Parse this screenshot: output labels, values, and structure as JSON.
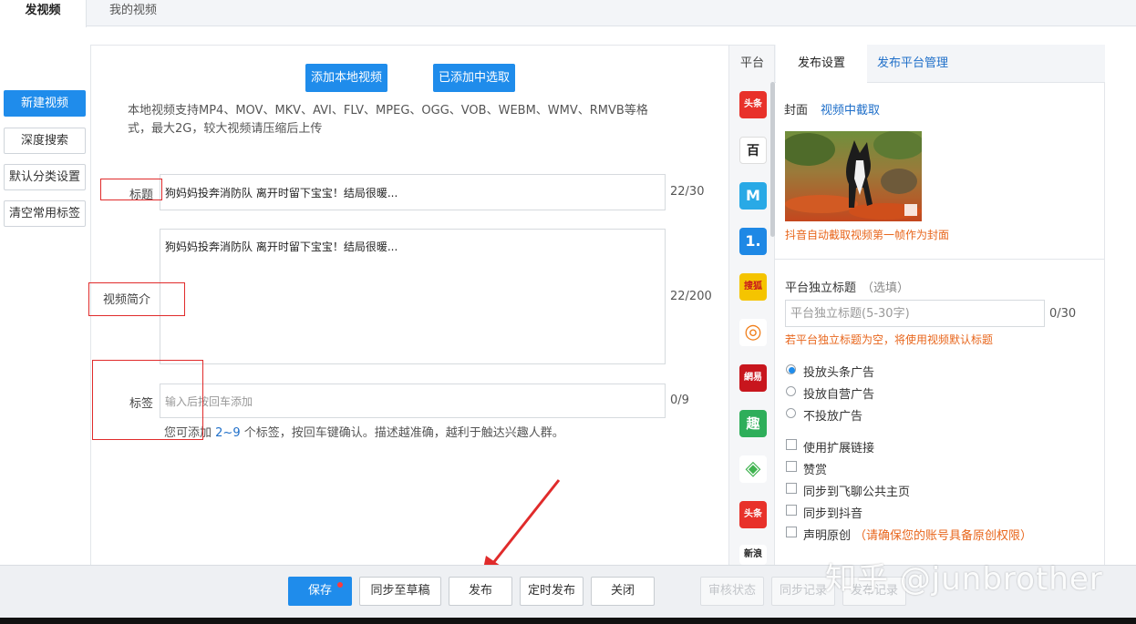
{
  "top_tabs": [
    "发视频",
    "我的视频"
  ],
  "sidebar": {
    "items": [
      "新建视频",
      "深度搜索",
      "默认分类设置",
      "清空常用标签"
    ]
  },
  "upload": {
    "add_local_label": "添加本地视频",
    "choose_added_label": "已添加中选取",
    "format_hint_line1": "本地视频支持MP4、MOV、MKV、AVI、FLV、MPEG、OGG、VOB、WEBM、WMV、RMVB等格",
    "format_hint_line2": "式，最大2G，较大视频请压缩后上传"
  },
  "form": {
    "title_label": "标题",
    "title_value": "狗妈妈投奔消防队 离开时留下宝宝！结局很暖...",
    "title_count": "22/30",
    "intro_label": "视频简介",
    "intro_value": "狗妈妈投奔消防队 离开时留下宝宝！结局很暖...",
    "intro_count": "22/200",
    "tags_label": "标签",
    "tags_placeholder": "输入后按回车添加",
    "tags_count": "0/9",
    "tags_hint_pre": "您可添加",
    "tags_hint_range": "2~9",
    "tags_hint_post": "个标签，按回车键确认。描述越准确，越利于触达兴趣人群。"
  },
  "platforms": {
    "header": "平台",
    "icons": [
      {
        "name": "toutiao-icon",
        "text": "头条",
        "color": "#e8312a"
      },
      {
        "name": "baidu-baijia-icon",
        "text": "百",
        "color": "#ffffff"
      },
      {
        "name": "m-platform-icon",
        "text": "M",
        "color": "#29a9e6"
      },
      {
        "name": "yidian-icon",
        "text": "1.",
        "color": "#1e88e5"
      },
      {
        "name": "sohu-icon",
        "text": "搜狐",
        "color": "#f5c400"
      },
      {
        "name": "spiral-icon",
        "text": "◎",
        "color": "#ffffff"
      },
      {
        "name": "netease-icon",
        "text": "網易",
        "color": "#c8161d"
      },
      {
        "name": "qutoutiao-icon",
        "text": "趣",
        "color": "#2eae5a"
      },
      {
        "name": "diamond-icon",
        "text": "◈",
        "color": "#ffffff"
      },
      {
        "name": "toutiao-alt-icon",
        "text": "头条",
        "color": "#e8312a"
      },
      {
        "name": "sina-icon",
        "text": "新浪",
        "color": "#ffffff"
      }
    ]
  },
  "settings": {
    "tab_publish": "发布设置",
    "tab_manage": "发布平台管理",
    "cover_label": "封面",
    "cover_link": "视频中截取",
    "cover_note": "抖音自动截取视频第一帧作为封面",
    "indep_title_label": "平台独立标题",
    "indep_title_optional": "（选填）",
    "indep_title_placeholder": "平台独立标题(5-30字)",
    "indep_title_count": "0/30",
    "indep_title_note": "若平台独立标题为空，将使用视频默认标题",
    "ads": {
      "options": [
        "投放头条广告",
        "投放自营广告",
        "不投放广告"
      ],
      "selected": "投放头条广告"
    },
    "options": [
      {
        "label": "使用扩展链接",
        "checked": false
      },
      {
        "label": "赞赏",
        "checked": false
      },
      {
        "label": "同步到飞聊公共主页",
        "checked": false
      },
      {
        "label": "同步到抖音",
        "checked": false
      },
      {
        "label": "声明原创",
        "checked": false
      }
    ],
    "original_note": "（请确保您的账号具备原创权限）"
  },
  "bottom": {
    "save": "保存",
    "sync_draft": "同步至草稿",
    "publish": "发布",
    "scheduled": "定时发布",
    "close": "关闭",
    "review_status": "审核状态",
    "sync_record": "同步记录",
    "publish_record": "发布记录"
  },
  "watermark": "知乎 @junbrother",
  "colors": {
    "accent": "#1f8ceb",
    "warning": "#e8661c",
    "annotation": "#e02b2b"
  }
}
